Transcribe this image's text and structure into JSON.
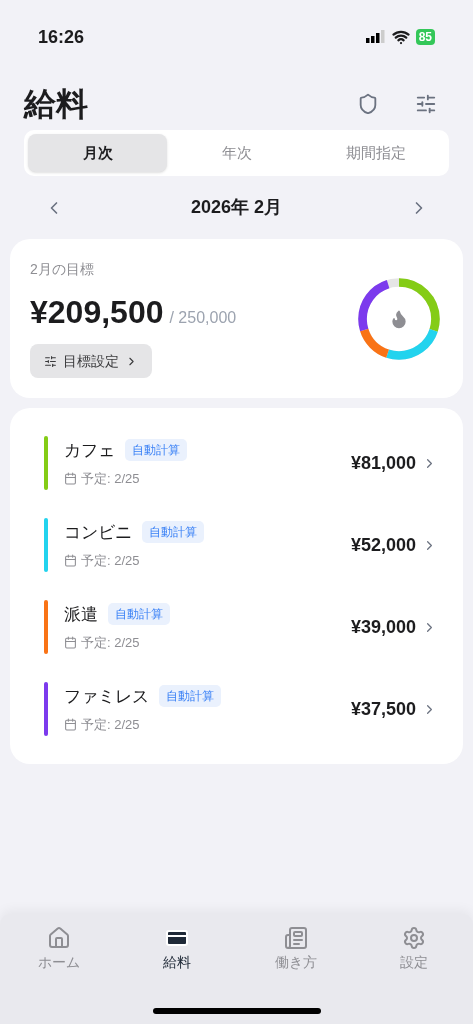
{
  "status_bar": {
    "time": "16:26",
    "battery": "85"
  },
  "title": "給料",
  "tabs": [
    {
      "label": "月次",
      "selected": true
    },
    {
      "label": "年次",
      "selected": false
    },
    {
      "label": "期間指定",
      "selected": false
    }
  ],
  "month_nav": {
    "label": "2026年 2月"
  },
  "goal": {
    "label": "2月の目標",
    "amount": "¥209,500",
    "target": "/ 250,000",
    "button": "目標設定"
  },
  "jobs": [
    {
      "name": "カフェ",
      "badge": "自動計算",
      "date": "予定: 2/25",
      "amount": "¥81,000",
      "color": "#84cc16"
    },
    {
      "name": "コンビニ",
      "badge": "自動計算",
      "date": "予定: 2/25",
      "amount": "¥52,000",
      "color": "#22d3ee"
    },
    {
      "name": "派遣",
      "badge": "自動計算",
      "date": "予定: 2/25",
      "amount": "¥39,000",
      "color": "#f97316"
    },
    {
      "name": "ファミレス",
      "badge": "自動計算",
      "date": "予定: 2/25",
      "amount": "¥37,500",
      "color": "#7c3aed"
    }
  ],
  "bottom_nav": [
    {
      "label": "ホーム",
      "kind": "home",
      "selected": false
    },
    {
      "label": "給料",
      "kind": "card",
      "selected": true
    },
    {
      "label": "働き方",
      "kind": "doc",
      "selected": false
    },
    {
      "label": "設定",
      "kind": "gear",
      "selected": false
    }
  ]
}
